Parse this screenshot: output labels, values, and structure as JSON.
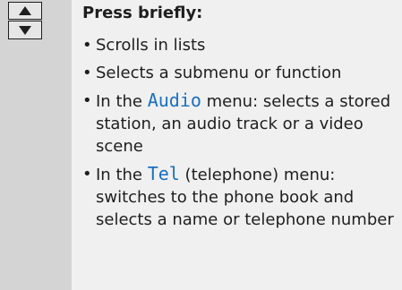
{
  "keys": [
    {
      "name": "up-arrow-key",
      "icon": "triangle-up-icon"
    },
    {
      "name": "down-arrow-key",
      "icon": "triangle-down-icon"
    }
  ],
  "heading": "Press briefly:",
  "accent_color": "#1a6fc0",
  "bullet": "•",
  "items": [
    {
      "text": "Scrolls in lists"
    },
    {
      "text": "Selects a submenu or function"
    },
    {
      "prefix": "In the ",
      "menu": "Audio",
      "suffix": " menu: selects a stored station, an audio track or a video scene"
    },
    {
      "prefix": "In the ",
      "menu": "Tel",
      "suffix": " (telephone) menu: switches to the phone book and selects a name or telephone number"
    }
  ]
}
